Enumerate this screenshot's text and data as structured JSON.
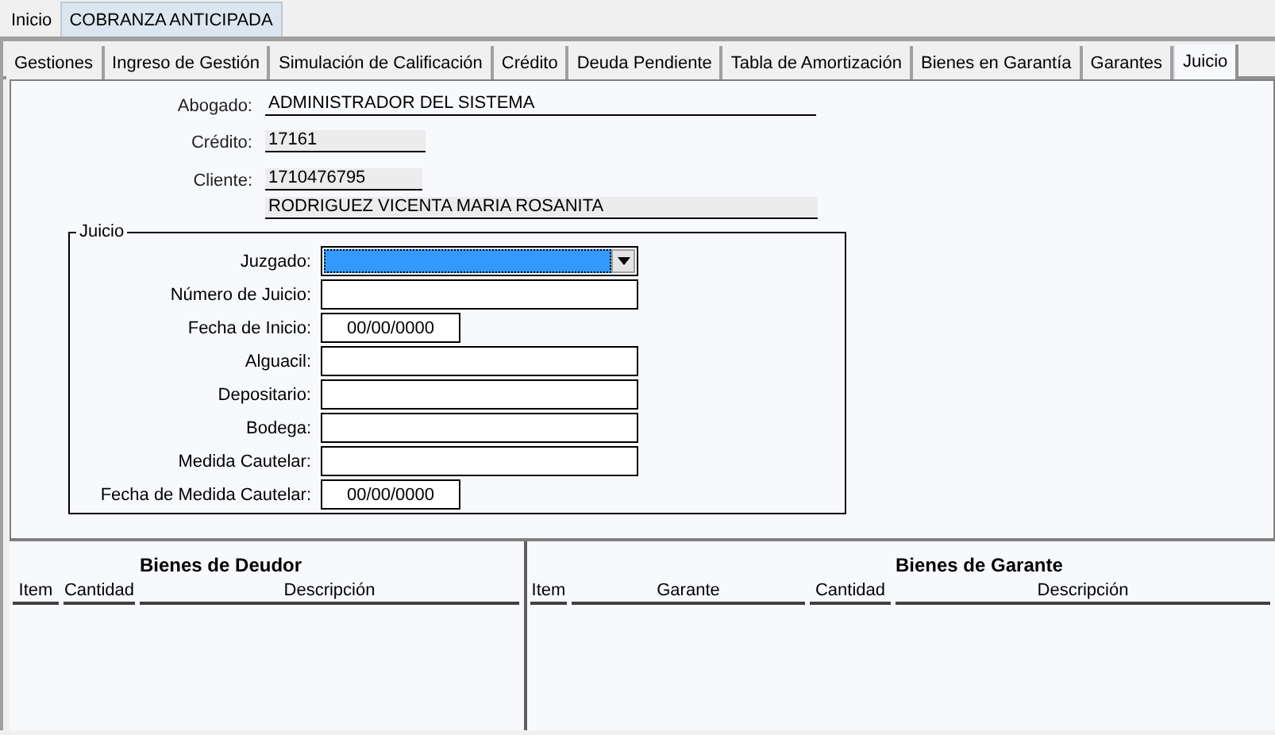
{
  "top_tabs": [
    {
      "label": "Inicio",
      "selected": false
    },
    {
      "label": "COBRANZA ANTICIPADA",
      "selected": true
    }
  ],
  "tabs": [
    {
      "label": "Gestiones",
      "selected": false
    },
    {
      "label": "Ingreso de Gestión",
      "selected": false
    },
    {
      "label": "Simulación de Calificación",
      "selected": false
    },
    {
      "label": "Crédito",
      "selected": false
    },
    {
      "label": "Deuda Pendiente",
      "selected": false
    },
    {
      "label": "Tabla de Amortización",
      "selected": false
    },
    {
      "label": "Bienes en Garantía",
      "selected": false
    },
    {
      "label": "Garantes",
      "selected": false
    },
    {
      "label": "Juicio",
      "selected": true
    }
  ],
  "header": {
    "abogado_label": "Abogado:",
    "abogado": "ADMINISTRADOR DEL SISTEMA",
    "credito_label": "Crédito:",
    "credito": "17161",
    "cliente_label": "Cliente:",
    "cliente_id": "1710476795",
    "cliente_nombre": "RODRIGUEZ VICENTA MARIA ROSANITA"
  },
  "juicio": {
    "legend": "Juicio",
    "fields": [
      {
        "label": "Juzgado:",
        "kind": "select",
        "focused": true
      },
      {
        "label": "Número de Juicio:",
        "kind": "text"
      },
      {
        "label": "Fecha de Inicio:",
        "kind": "date",
        "value": "00/00/0000"
      },
      {
        "label": "Alguacil:",
        "kind": "text"
      },
      {
        "label": "Depositario:",
        "kind": "text"
      },
      {
        "label": "Bodega:",
        "kind": "text"
      },
      {
        "label": "Medida Cautelar:",
        "kind": "text"
      },
      {
        "label": "Fecha de Medida Cautelar:",
        "kind": "date",
        "value": "00/00/0000"
      }
    ]
  },
  "tables": [
    {
      "title": "Bienes de Deudor",
      "columns": [
        "Item",
        "Cantidad",
        "Descripción"
      ]
    },
    {
      "title": "Bienes de Garante",
      "columns": [
        "Item",
        "Garante",
        "Cantidad",
        "Descripción"
      ]
    }
  ]
}
